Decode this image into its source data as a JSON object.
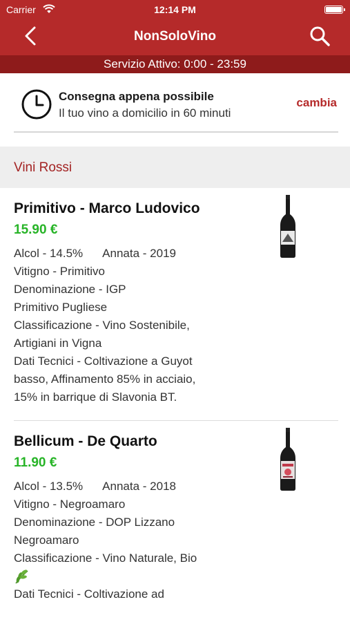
{
  "status_bar": {
    "carrier": "Carrier",
    "time": "12:14 PM",
    "wifi_icon": "wifi-icon",
    "battery_level": 1.0
  },
  "nav": {
    "title": "NonSoloVino",
    "back_icon": "chevron-left-icon",
    "search_icon": "search-icon"
  },
  "service": {
    "text": "Servizio Attivo: 0:00 - 23:59"
  },
  "delivery": {
    "icon": "clock-icon",
    "title": "Consegna appena possibile",
    "subtitle": "Il tuo vino a domicilio in 60 minuti",
    "change_label": "cambia"
  },
  "section": {
    "title": "Vini Rossi"
  },
  "products": [
    {
      "name": "Primitivo - Marco Ludovico",
      "price": "15.90 €",
      "alcol": "Alcol - 14.5%",
      "annata": "Annata - 2019",
      "lines": [
        "Vitigno - Primitivo",
        "Denominazione - IGP",
        "Primitivo Pugliese",
        "Classificazione - Vino Sostenibile,",
        "Artigiani in Vigna",
        "Dati Tecnici - Coltivazione a Guyot",
        "basso, Affinamento 85% in acciaio,",
        "15% in barrique di Slavonia BT."
      ]
    },
    {
      "name": "Bellicum - De Quarto",
      "price": "11.90 €",
      "alcol": "Alcol - 13.5%",
      "annata": "Annata - 2018",
      "lines_before_icon": [
        "Vitigno - Negroamaro",
        "Denominazione - DOP Lizzano",
        "Negroamaro",
        "Classificazione - Vino Naturale, Bio"
      ],
      "lines_after_icon": [
        "Dati Tecnici - Coltivazione ad"
      ],
      "icon": "leaf-icon"
    }
  ],
  "colors": {
    "primary": "#b52a2a",
    "service_bar": "#8e1b1b",
    "price": "#27b427",
    "section_bg": "#eeeeee"
  }
}
